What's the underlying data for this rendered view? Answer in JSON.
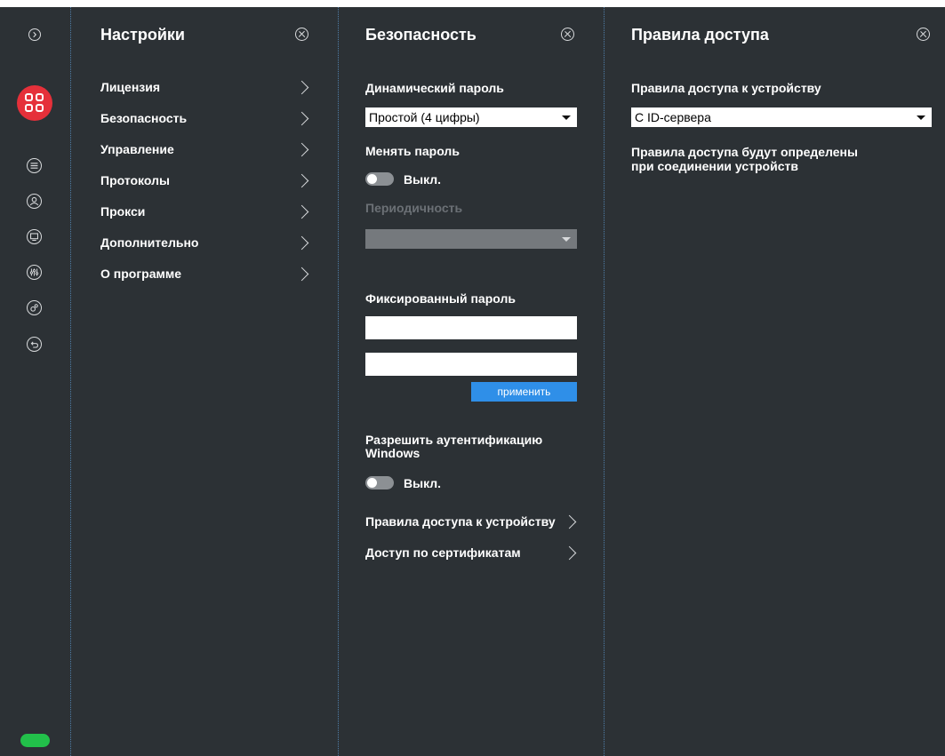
{
  "settings": {
    "title": "Настройки",
    "items": [
      {
        "label": "Лицензия"
      },
      {
        "label": "Безопасность"
      },
      {
        "label": "Управление"
      },
      {
        "label": "Протоколы"
      },
      {
        "label": "Прокси"
      },
      {
        "label": "Дополнительно"
      },
      {
        "label": "О программе"
      }
    ]
  },
  "security": {
    "title": "Безопасность",
    "dynamic_password_label": "Динамический пароль",
    "dynamic_password_value": "Простой (4 цифры)",
    "change_password_label": "Менять пароль",
    "change_password_toggle": "Выкл.",
    "periodicity_label": "Периодичность",
    "periodicity_value": "",
    "fixed_password_label": "Фиксированный пароль",
    "password_value": "",
    "password_confirm_value": "",
    "apply_label": "применить",
    "windows_auth_label_line1": "Разрешить аутентификацию",
    "windows_auth_label_line2": "Windows",
    "windows_auth_toggle": "Выкл.",
    "access_rules_link": "Правила доступа к устройству",
    "cert_access_link": "Доступ по сертификатам"
  },
  "access": {
    "title": "Правила доступа",
    "rules_label": "Правила доступа к устройству",
    "rules_value": "С ID-сервера",
    "note_line1": "Правила доступа будут определены",
    "note_line2": "при соединении устройств"
  },
  "colors": {
    "background": "#2c3135",
    "accent_red": "#e5303a",
    "apply_blue": "#2f8fe8",
    "status_green": "#22c04a"
  },
  "rail_icons": [
    "collapse-icon",
    "apps-icon",
    "list-icon",
    "contacts-icon",
    "monitor-icon",
    "equalizer-icon",
    "settings-gears-icon",
    "undo-icon"
  ]
}
